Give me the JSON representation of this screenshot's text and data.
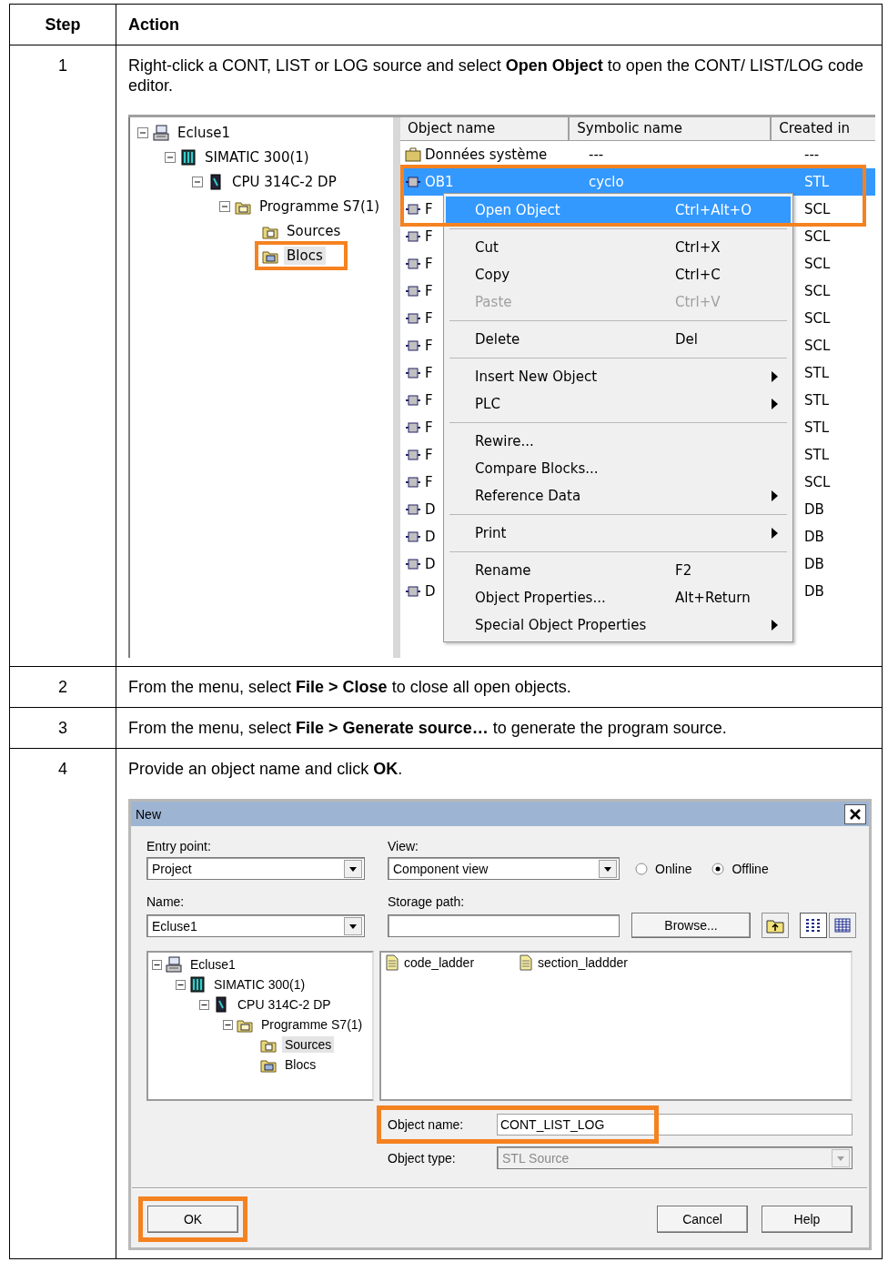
{
  "table": {
    "columns": [
      "Step",
      "Action"
    ],
    "rows": [
      {
        "step": "1",
        "text": "Right-click a CONT, LIST or LOG source and select **Open Object** to open the CONT/ LIST/LOG code editor.",
        "screen": {
          "kind": "explorer",
          "tree": [
            {
              "kind": "project",
              "label": "Ecluse1",
              "expanded": true,
              "selected": false,
              "children": [
                {
                  "kind": "station",
                  "label": "SIMATIC 300(1)",
                  "expanded": true,
                  "selected": false,
                  "children": [
                    {
                      "kind": "cpu",
                      "label": "CPU 314C-2 DP",
                      "expanded": true,
                      "selected": false,
                      "children": [
                        {
                          "kind": "program",
                          "label": "Programme S7(1)",
                          "expanded": true,
                          "selected": false,
                          "children": [
                            {
                              "kind": "sources",
                              "label": "Sources",
                              "selected": false
                            },
                            {
                              "kind": "blocks",
                              "label": "Blocs",
                              "selected": true,
                              "highlighted": true
                            }
                          ]
                        }
                      ]
                    }
                  ]
                }
              ]
            }
          ],
          "list": {
            "columns": [
              "Object name",
              "Symbolic name",
              "Created in"
            ],
            "rows": [
              {
                "kind": "system",
                "name": "Données système",
                "symbolic": "---",
                "created": "---",
                "selected": false
              },
              {
                "kind": "block",
                "name": "OB1",
                "symbolic": "cyclo",
                "created": "STL",
                "selected": true,
                "highlighted": true
              },
              {
                "kind": "block",
                "name": "F",
                "created": "SCL",
                "selected": false
              },
              {
                "kind": "block",
                "name": "F",
                "created": "SCL",
                "selected": false
              },
              {
                "kind": "block",
                "name": "F",
                "created": "SCL",
                "selected": false
              },
              {
                "kind": "block",
                "name": "F",
                "created": "SCL",
                "selected": false
              },
              {
                "kind": "block",
                "name": "F",
                "created": "SCL",
                "selected": false
              },
              {
                "kind": "block",
                "name": "F",
                "created": "SCL",
                "selected": false
              },
              {
                "kind": "block",
                "name": "F",
                "created": "STL",
                "selected": false
              },
              {
                "kind": "block",
                "name": "F",
                "created": "STL",
                "selected": false
              },
              {
                "kind": "block",
                "name": "F",
                "created": "STL",
                "selected": false
              },
              {
                "kind": "block",
                "name": "F",
                "created": "STL",
                "selected": false
              },
              {
                "kind": "block",
                "name": "F",
                "created": "SCL",
                "selected": false
              },
              {
                "kind": "block",
                "name": "D",
                "created": "DB",
                "selected": false
              },
              {
                "kind": "block",
                "name": "D",
                "created": "DB",
                "selected": false
              },
              {
                "kind": "block",
                "name": "D",
                "created": "DB",
                "selected": false
              },
              {
                "kind": "block",
                "name": "D",
                "created": "DB",
                "selected": false
              }
            ]
          },
          "menu": [
            {
              "kind": "item",
              "label": "Open Object",
              "shortcut": "Ctrl+Alt+O",
              "selected": true,
              "disabled": false,
              "submenu": false,
              "highlighted": true
            },
            {
              "kind": "separator"
            },
            {
              "kind": "item",
              "label": "Cut",
              "shortcut": "Ctrl+X",
              "selected": false,
              "disabled": false,
              "submenu": false
            },
            {
              "kind": "item",
              "label": "Copy",
              "shortcut": "Ctrl+C",
              "selected": false,
              "disabled": false,
              "submenu": false
            },
            {
              "kind": "item",
              "label": "Paste",
              "shortcut": "Ctrl+V",
              "selected": false,
              "disabled": true,
              "submenu": false
            },
            {
              "kind": "separator"
            },
            {
              "kind": "item",
              "label": "Delete",
              "shortcut": "Del",
              "selected": false,
              "disabled": false,
              "submenu": false
            },
            {
              "kind": "separator"
            },
            {
              "kind": "item",
              "label": "Insert New Object",
              "selected": false,
              "disabled": false,
              "submenu": true
            },
            {
              "kind": "item",
              "label": "PLC",
              "selected": false,
              "disabled": false,
              "submenu": true
            },
            {
              "kind": "separator"
            },
            {
              "kind": "item",
              "label": "Rewire...",
              "selected": false,
              "disabled": false,
              "submenu": false
            },
            {
              "kind": "item",
              "label": "Compare Blocks...",
              "selected": false,
              "disabled": false,
              "submenu": false
            },
            {
              "kind": "item",
              "label": "Reference Data",
              "selected": false,
              "disabled": false,
              "submenu": true
            },
            {
              "kind": "separator"
            },
            {
              "kind": "item",
              "label": "Print",
              "selected": false,
              "disabled": false,
              "submenu": true
            },
            {
              "kind": "separator"
            },
            {
              "kind": "item",
              "label": "Rename",
              "shortcut": "F2",
              "selected": false,
              "disabled": false,
              "submenu": false
            },
            {
              "kind": "item",
              "label": "Object Properties...",
              "shortcut": "Alt+Return",
              "selected": false,
              "disabled": false,
              "submenu": false
            },
            {
              "kind": "item",
              "label": "Special Object Properties",
              "selected": false,
              "disabled": false,
              "submenu": true
            }
          ]
        }
      },
      {
        "step": "2",
        "text": "From the menu, select **File > Close** to close all open objects."
      },
      {
        "step": "3",
        "text": "From the menu, select **File > Generate source…** to generate the program source."
      },
      {
        "step": "4",
        "text": "Provide an object name and click **OK**.",
        "screen": {
          "kind": "dialog",
          "title": "New",
          "entry_point": {
            "label": "Entry point:",
            "value": "Project"
          },
          "view": {
            "label": "View:",
            "value": "Component view"
          },
          "modes": [
            {
              "label": "Online",
              "selected": false
            },
            {
              "label": "Offline",
              "selected": true
            }
          ],
          "name": {
            "label": "Name:",
            "value": "Ecluse1"
          },
          "storage_path": {
            "label": "Storage path:"
          },
          "browse": "Browse...",
          "view_buttons": [
            {
              "kind": "list",
              "selected": true
            },
            {
              "kind": "details",
              "selected": false
            }
          ],
          "tree": [
            {
              "kind": "project",
              "label": "Ecluse1",
              "expanded": true,
              "selected": false,
              "children": [
                {
                  "kind": "station",
                  "label": "SIMATIC 300(1)",
                  "expanded": true,
                  "selected": false,
                  "children": [
                    {
                      "kind": "cpu",
                      "label": "CPU 314C-2 DP",
                      "expanded": true,
                      "selected": false,
                      "children": [
                        {
                          "kind": "program",
                          "label": "Programme S7(1)",
                          "expanded": true,
                          "selected": false,
                          "children": [
                            {
                              "kind": "sources",
                              "label": "Sources",
                              "selected": true
                            },
                            {
                              "kind": "blocks",
                              "label": "Blocs",
                              "selected": false
                            }
                          ]
                        }
                      ]
                    }
                  ]
                }
              ]
            }
          ],
          "files": [
            {
              "name": "code_ladder"
            },
            {
              "name": "section_laddder"
            }
          ],
          "object_name": {
            "label": "Object name:",
            "value": "CONT_LIST_LOG",
            "highlighted": true
          },
          "object_type": {
            "label": "Object type:",
            "value": "STL Source",
            "disabled": true
          },
          "buttons": [
            {
              "label": "OK",
              "highlighted": true
            },
            {
              "label": "Cancel",
              "highlighted": false
            },
            {
              "label": "Help",
              "highlighted": false
            }
          ]
        }
      }
    ]
  }
}
